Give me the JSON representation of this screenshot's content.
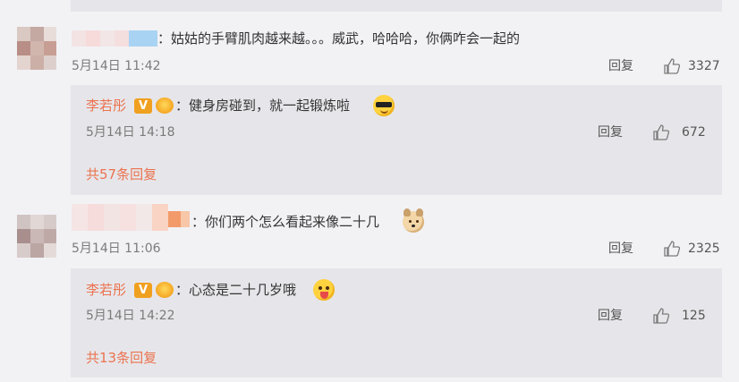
{
  "comments": [
    {
      "text": "：姑姑的手臂肌肉越来越。。。威武，哈哈哈，你俩咋会一起的",
      "date": "5月14日 11:42",
      "reply_label": "回复",
      "likes": "3327",
      "replies": [
        {
          "author": "李若彤",
          "text": "：健身房碰到，就一起锻炼啦",
          "emoji": "cool-sunglasses-emoji",
          "date": "5月14日 14:18",
          "reply_label": "回复",
          "likes": "672"
        }
      ],
      "more_replies": "共57条回复"
    },
    {
      "text": "：你们两个怎么看起来像二十几",
      "emoji": "doge-emoji",
      "date": "5月14日 11:06",
      "reply_label": "回复",
      "likes": "2325",
      "replies": [
        {
          "author": "李若彤",
          "text": "：心态是二十几岁哦",
          "emoji": "tongue-out-emoji",
          "date": "5月14日 14:22",
          "reply_label": "回复",
          "likes": "125"
        }
      ],
      "more_replies": "共13条回复"
    }
  ],
  "badges": {
    "verified": "V"
  },
  "colors": {
    "page_bg": "#f2f2f5",
    "reply_bg": "#e6e6ea",
    "accent": "#eb7350",
    "meta_text": "#7b7b7b"
  }
}
